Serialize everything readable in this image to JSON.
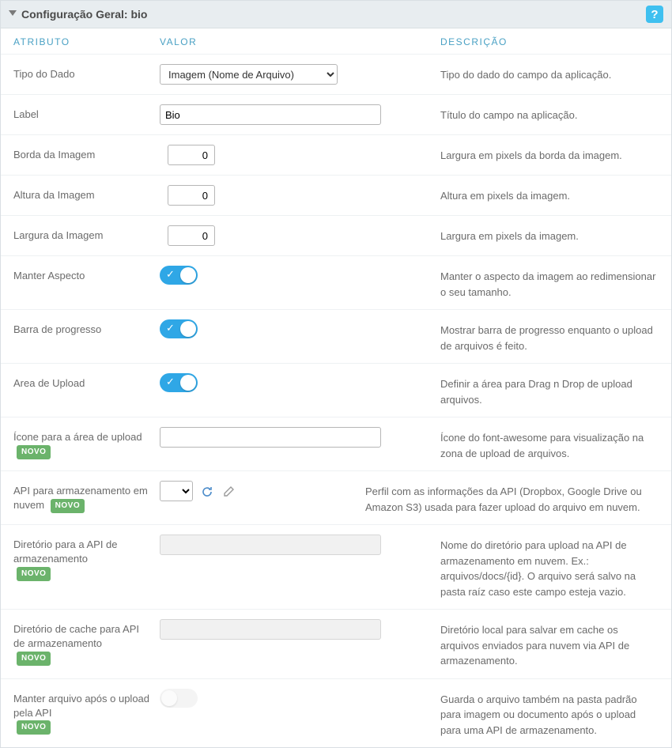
{
  "panel": {
    "title": "Configuração Geral: bio",
    "help_icon": "?"
  },
  "columns": {
    "attr": "ATRIBUTO",
    "val": "VALOR",
    "desc": "DESCRIÇÃO"
  },
  "novo_label": "NOVO",
  "rows": [
    {
      "attr": "Tipo do Dado",
      "control": "select",
      "value": "Imagem (Nome de Arquivo)",
      "desc": "Tipo do dado do campo da aplicação."
    },
    {
      "attr": "Label",
      "control": "text",
      "value": "Bio",
      "desc": "Título do campo na aplicação."
    },
    {
      "attr": "Borda da Imagem",
      "control": "number",
      "value": "0",
      "desc": "Largura em pixels da borda da imagem."
    },
    {
      "attr": "Altura da Imagem",
      "control": "number",
      "value": "0",
      "desc": "Altura em pixels da imagem."
    },
    {
      "attr": "Largura da Imagem",
      "control": "number",
      "value": "0",
      "desc": "Largura em pixels da imagem."
    },
    {
      "attr": "Manter Aspecto",
      "control": "toggle-on",
      "desc": "Manter o aspecto da imagem ao redimensionar o seu tamanho."
    },
    {
      "attr": "Barra de progresso",
      "control": "toggle-on",
      "desc": "Mostrar barra de progresso enquanto o upload de arquivos é feito."
    },
    {
      "attr": "Area de Upload",
      "control": "toggle-on",
      "desc": "Definir a área para Drag n Drop de upload arquivos."
    },
    {
      "attr": "Ícone para a área de upload",
      "novo": true,
      "control": "text-wide",
      "value": "",
      "desc": "Ícone do font-awesome para visualização na zona de upload de arquivos."
    },
    {
      "attr": "API para armazenamento em nuvem",
      "novo": true,
      "control": "api-picker",
      "desc": "Perfil com as informações da API (Dropbox, Google Drive ou Amazon S3) usada para fazer upload do arquivo em nuvem."
    },
    {
      "attr": "Diretório para a API de armazenamento",
      "novo": true,
      "control": "disabled-text",
      "desc": "Nome do diretório para upload na API de armazenamento em nuvem. Ex.: arquivos/docs/{id}. O arquivo será salvo na pasta raíz caso este campo esteja vazio."
    },
    {
      "attr": "Diretório de cache para API de armazenamento",
      "novo": true,
      "control": "disabled-text",
      "desc": "Diretório local para salvar em cache os arquivos enviados para nuvem via API de armazenamento."
    },
    {
      "attr": "Manter arquivo após o upload pela API",
      "novo": true,
      "control": "toggle-off-disabled",
      "desc": "Guarda o arquivo também na pasta padrão para imagem ou documento após o upload para uma API de armazenamento."
    }
  ]
}
